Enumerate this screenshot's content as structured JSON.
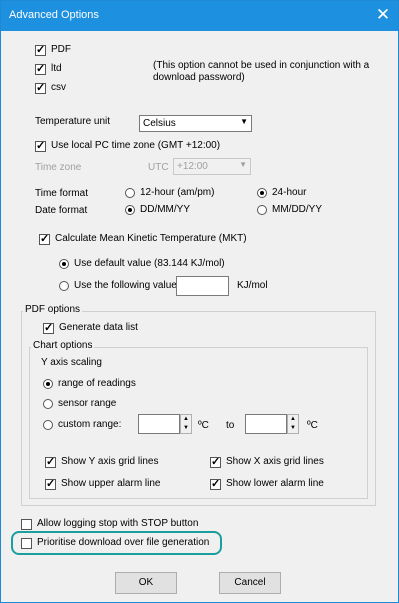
{
  "window": {
    "title": "Advanced Options",
    "close_label": "✕"
  },
  "export": {
    "pdf": "PDF",
    "ltd": "ltd",
    "csv": "csv",
    "note": [
      "(This option cannot be used in conjunction with a",
      "download password)"
    ]
  },
  "temperature": {
    "label": "Temperature unit",
    "value": "Celsius"
  },
  "time": {
    "use_local_label": "Use local PC time zone (GMT +12:00)",
    "timezone_label": "Time zone",
    "utc_label": "UTC",
    "utc_value": "+12:00",
    "time_format_label": "Time format",
    "opt_12h": "12-hour (am/pm)",
    "opt_24h": "24-hour",
    "date_format_label": "Date format",
    "opt_ddmm": "DD/MM/YY",
    "opt_mmdd": "MM/DD/YY"
  },
  "mkt": {
    "label": "Calculate Mean Kinetic Temperature (MKT)",
    "default_label": "Use default value (83.144 KJ/mol)",
    "following_label": "Use the following value",
    "unit": "KJ/mol"
  },
  "pdf_options": {
    "legend": "PDF options",
    "generate_data_list": "Generate data list",
    "chart_options_legend": "Chart options",
    "y_axis_scaling": "Y axis scaling",
    "range_readings": "range of readings",
    "sensor_range": "sensor range",
    "custom_range": "custom range:",
    "deg_c": "ºC",
    "to": "to",
    "show_y_grid": "Show Y axis grid lines",
    "show_x_grid": "Show X axis grid lines",
    "show_upper_alarm": "Show upper alarm line",
    "show_lower_alarm": "Show lower alarm line"
  },
  "logging": {
    "allow_stop": "Allow logging stop with STOP button",
    "prioritise": "Prioritise download over file generation"
  },
  "buttons": {
    "ok": "OK",
    "cancel": "Cancel"
  },
  "colors": {
    "titlebar": "#1e90e0",
    "highlight": "#1a9e9e"
  }
}
